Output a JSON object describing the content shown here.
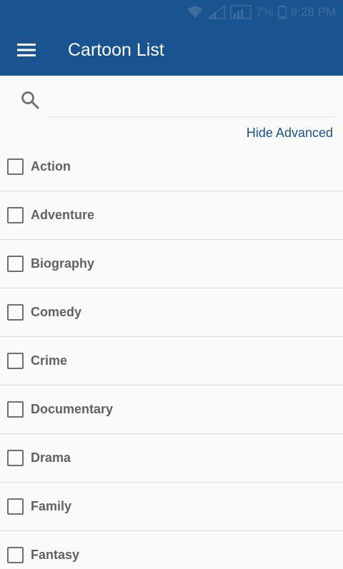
{
  "status_bar": {
    "battery_text": "7%",
    "time": "9:28 PM",
    "icons": [
      "wifi-icon",
      "signal-icon",
      "signal-icon",
      "battery-icon"
    ]
  },
  "app_bar": {
    "title": "Cartoon List",
    "menu_icon": "hamburger-menu-icon",
    "color": "#1a5490"
  },
  "search": {
    "icon": "search-icon",
    "value": "",
    "placeholder": ""
  },
  "advanced_toggle_label": "Hide Advanced",
  "genres": [
    {
      "label": "Action",
      "checked": false
    },
    {
      "label": "Adventure",
      "checked": false
    },
    {
      "label": "Biography",
      "checked": false
    },
    {
      "label": "Comedy",
      "checked": false
    },
    {
      "label": "Crime",
      "checked": false
    },
    {
      "label": "Documentary",
      "checked": false
    },
    {
      "label": "Drama",
      "checked": false
    },
    {
      "label": "Family",
      "checked": false
    },
    {
      "label": "Fantasy",
      "checked": false
    }
  ]
}
